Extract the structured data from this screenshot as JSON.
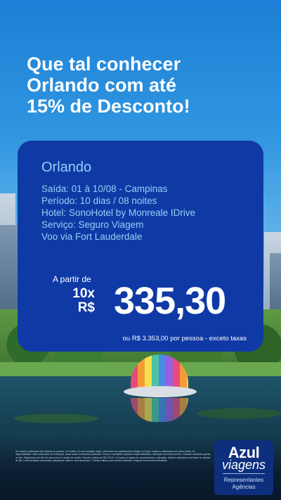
{
  "headline": {
    "line1": "Que tal conhecer",
    "line2": "Orlando com até",
    "line3": "15% de Desconto!"
  },
  "offer": {
    "city": "Orlando",
    "details": [
      "Saída: 01 à 10/08 - Campinas",
      "Período: 10 dias / 08 noites",
      "Hotel: SonoHotel by Monreale IDrive",
      "Serviço: Seguro Viagem",
      "Voo via Fort Lauderdale"
    ],
    "from_label": "A partir de",
    "installments": "10x",
    "currency": "R$",
    "price": "335,30",
    "total_note": "ou R$ 3.353,00 por pessoa - exceto taxas"
  },
  "footer": {
    "legal": "Os valores publicados são válidos por pessoa, em Hotéis, em acomodação dupla, referentes aos apartamentos Single ou Duplo, sujeitos a alteração sem aviso prévio e à disponibilidade. Não inclui taxas de embarque, taxas locais e despesas pessoais. Preços e condições sujeitos à disponibilidade e alteração sem aviso prévio. Consulte condições gerais no site. Pagamento em até 10x sem juros no cartão de crédito. Parcela mínima de R$ 100,00. Consulte as regras de cancelamento e alteração. Valores calculados com base no câmbio do dia. Documentação necessária: passaporte válido e visto americano. Ofertas válidas para saídas indicadas. Imagens meramente ilustrativas.",
    "brand": "Azul",
    "brand_sub": "viagens",
    "tag1": "Representantes",
    "tag2": "Agências"
  }
}
